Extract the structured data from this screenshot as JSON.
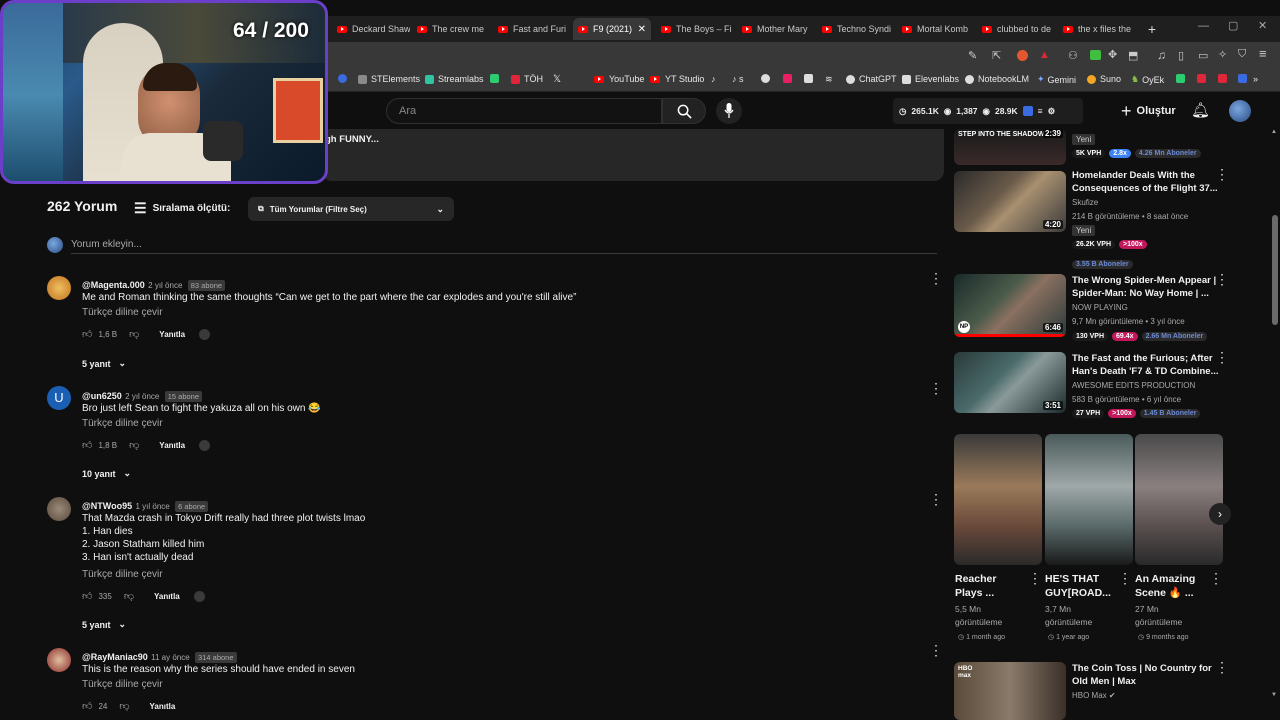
{
  "browser": {
    "tabs": [
      {
        "label": "Deckard Shaw"
      },
      {
        "label": "The crew me"
      },
      {
        "label": "Fast and Furi"
      },
      {
        "label": "F9 (2021) -",
        "active": true
      },
      {
        "label": "The Boys – Fi"
      },
      {
        "label": "Mother Mary"
      },
      {
        "label": "Techno Syndi"
      },
      {
        "label": "Mortal Komb"
      },
      {
        "label": "clubbed to de"
      },
      {
        "label": "the x files the"
      }
    ],
    "new_tab": "+",
    "bookmarks": [
      {
        "label": "STElements",
        "color": "#8a8a8a"
      },
      {
        "label": "Streamlabs",
        "color": "#31c3a2"
      },
      {
        "label": "TÖH",
        "color": "#e0273a"
      },
      {
        "label": "YouTube",
        "color": "#ff0000"
      },
      {
        "label": "YT Studio",
        "color": "#ff0000"
      },
      {
        "label": "ChatGPT",
        "color": "#dddddd"
      },
      {
        "label": "Elevenlabs",
        "color": "#dddddd"
      },
      {
        "label": "NotebookLM",
        "color": "#dddddd"
      },
      {
        "label": "Gemini",
        "color": "#7aa7ff"
      },
      {
        "label": "Suno",
        "color": "#f5a623"
      },
      {
        "label": "OyEk",
        "color": "#8bc34a"
      }
    ]
  },
  "overlay": {
    "counter": "64 / 200"
  },
  "header": {
    "search_placeholder": "Ara",
    "stats": [
      "265.1K",
      "1,387",
      "28.9K"
    ],
    "create_label": "Oluştur"
  },
  "description": {
    "snippet": "gh FUNNY..."
  },
  "comments_header": {
    "count": "262 Yorum",
    "sort_label": "Sıralama ölçütü:",
    "filter_label": "Tüm Yorumlar (Filtre Seç)",
    "add_placeholder": "Yorum ekleyin..."
  },
  "comments": [
    {
      "handle": "@Magenta.000",
      "ago": "2 yıl önce",
      "subs": "83 abone",
      "text": [
        "Me and Roman thinking the same thoughts “Can we get to the part where the car explodes and you're still alive”"
      ],
      "translate": "Türkçe diline çevir",
      "likes": "1,6 B",
      "reply": "Yanıtla",
      "replies": "5 yanıt",
      "avatar": "#e8a83a"
    },
    {
      "handle": "@un6250",
      "ago": "2 yıl önce",
      "subs": "15 abone",
      "text": [
        "Bro just left Sean to fight the yakuza all on his own 😂"
      ],
      "translate": "Türkçe diline çevir",
      "likes": "1,8 B",
      "reply": "Yanıtla",
      "replies": "10 yanıt",
      "avatar": "#1a5fb4",
      "initial": "U"
    },
    {
      "handle": "@NTWoo95",
      "ago": "1 yıl önce",
      "subs": "6 abone",
      "text": [
        "That Mazda crash in Tokyo Drift really had three plot twists lmao",
        "1. Han dies",
        "2. Jason Statham killed him",
        "3. Han isn't actually dead"
      ],
      "translate": "Türkçe diline çevir",
      "likes": "335",
      "reply": "Yanıtla",
      "replies": "5 yanıt",
      "avatar": "#7a6a5a"
    },
    {
      "handle": "@RayManiac90",
      "ago": "11 ay önce",
      "subs": "314 abone",
      "text": [
        "This is the reason why the series should have ended in seven"
      ],
      "translate": "Türkçe diline çevir",
      "likes": "24",
      "reply": "Yanıtla",
      "avatar": "#8a2a2a"
    }
  ],
  "sidebar": {
    "top": {
      "title": "STEP INTO THE SHADOW",
      "duration": "2:39",
      "new": "Yeni",
      "vph": "5K VPH",
      "mult": "2.8x",
      "subs": "4.26 Mn Aboneler"
    },
    "videos": [
      {
        "title": [
          "Homelander Deals With the",
          "Consequences of the Flight 37..."
        ],
        "channel": "Skufize",
        "stats": "214 B görüntüleme • 8 saat önce",
        "new": "Yeni",
        "vph": "26.2K VPH",
        "mult": ">100x",
        "subs": "3.55 B Aboneler",
        "duration": "4:20"
      },
      {
        "title": [
          "The Wrong Spider-Men Appear |",
          "Spider-Man: No Way Home | ..."
        ],
        "channel": "NOW PLAYING",
        "stats": "9,7 Mn görüntüleme • 3 yıl önce",
        "vph": "130 VPH",
        "mult": "69.4x",
        "subs": "2.66 Mn Aboneler",
        "duration": "6:46"
      },
      {
        "title": [
          "The Fast and the Furious; After",
          "Han's Death 'F7 & TD Combine..."
        ],
        "channel": "AWESOME EDITS PRODUCTION",
        "stats": "583 B görüntüleme • 6 yıl önce",
        "vph": "27 VPH",
        "mult": ">100x",
        "subs": "1.45 B Aboneler",
        "duration": "3:51"
      }
    ],
    "shorts": [
      {
        "title": [
          "Reacher",
          "Plays ..."
        ],
        "views": "5,5 Mn",
        "views2": "görüntüleme",
        "ago": "1 month ago"
      },
      {
        "title": [
          "HE'S THAT",
          "GUY[ROAD..."
        ],
        "views": "3,7 Mn",
        "views2": "görüntüleme",
        "ago": "1 year ago"
      },
      {
        "title": [
          "An Amazing",
          "Scene 🔥 ..."
        ],
        "views": "27 Mn",
        "views2": "görüntüleme",
        "ago": "9 months ago"
      }
    ],
    "last": {
      "title": [
        "The Coin Toss | No Country for",
        "Old Men | Max"
      ],
      "channel": "HBO Max",
      "logo": "HBO max"
    }
  }
}
